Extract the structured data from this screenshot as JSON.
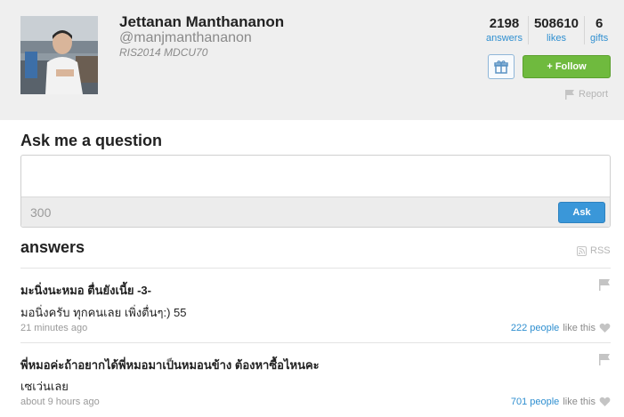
{
  "profile": {
    "name": "Jettanan Manthananon",
    "handle": "@manjmanthananon",
    "bio": "RIS2014 MDCU70"
  },
  "stats": [
    {
      "value": "2198",
      "label": "answers"
    },
    {
      "value": "508610",
      "label": "likes"
    },
    {
      "value": "6",
      "label": "gifts"
    }
  ],
  "actions": {
    "follow_label": "+ Follow",
    "report_label": "Report",
    "gift_icon": "gift-icon"
  },
  "ask": {
    "title": "Ask me a question",
    "placeholder": "",
    "char_count": "300",
    "button_label": "Ask"
  },
  "answers": {
    "title": "answers",
    "rss_label": "RSS",
    "items": [
      {
        "question": "มะนิ่งนะหมอ ตื่นยังเนี้ย -3-",
        "answer": "มอนิ่งครับ ทุกคนเลย เพิ่งตื่นๆ:) 55",
        "time": "21 minutes ago",
        "people": "222 people",
        "like_text": "like this"
      },
      {
        "question": "พี่หมอค่ะถ้าอยากได้พี่หมอมาเป็นหมอนข้าง ต้องหาซื้อไหนคะ",
        "answer": "เซเว่นเลย",
        "time": "about 9 hours ago",
        "people": "701 people",
        "like_text": "like this"
      }
    ]
  },
  "colors": {
    "accent_blue": "#2f8fd0",
    "follow_green": "#6fba3e",
    "ask_blue": "#3a97d9",
    "header_bg": "#efefef"
  }
}
